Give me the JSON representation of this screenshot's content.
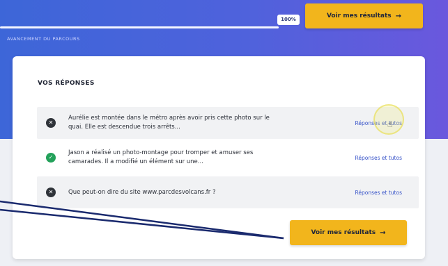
{
  "header": {
    "progress_value": "100%",
    "progress_fraction": 1.0,
    "progress_label": "AVANCEMENT DU PARCOURS",
    "cta_label": "Voir mes résultats",
    "cta_arrow": "→"
  },
  "card": {
    "title": "VOS RÉPONSES",
    "rows": [
      {
        "status": "wrong",
        "icon_glyph": "✕",
        "text": "Aurélie est montée dans le métro après avoir pris cette photo sur le quai. Elle est descendue trois arrêts...",
        "link": "Réponses et tutos"
      },
      {
        "status": "right",
        "icon_glyph": "✓",
        "text": "Jason a réalisé un photo-montage pour tromper et amuser ses camarades. Il a modifié un élément sur une...",
        "link": "Réponses et tutos"
      },
      {
        "status": "wrong",
        "icon_glyph": "✕",
        "text": "Que peut-on dire du site www.parcdesvolcans.fr ?",
        "link": "Réponses et tutos"
      }
    ],
    "cta_label": "Voir mes résultats",
    "cta_arrow": "→"
  },
  "colors": {
    "accent_yellow": "#f2b51c",
    "header_blue": "#4f62dc",
    "correct_green": "#23a15a",
    "wrong_dark": "#2f3339",
    "link_blue": "#3652c8",
    "annotation_navy": "#1a2a6e"
  },
  "icons": {
    "wrong": "x-circle-icon",
    "right": "check-circle-icon",
    "cursor": "hand-pointer-icon",
    "arrow": "arrow-right-icon"
  }
}
